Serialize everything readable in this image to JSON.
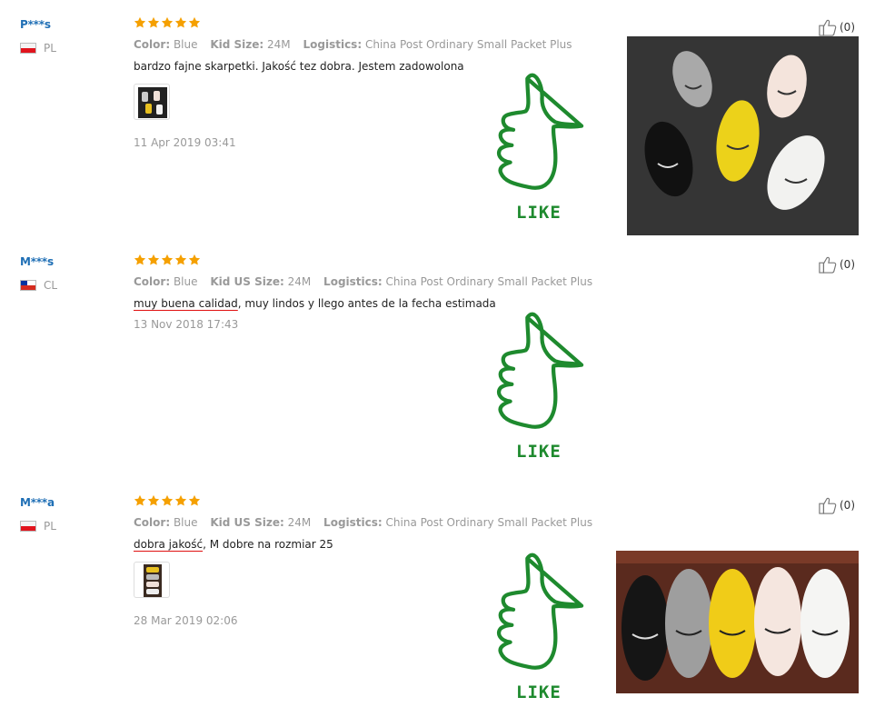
{
  "reviews": [
    {
      "user": "P***s",
      "country": "PL",
      "rating": 5,
      "meta": {
        "color_label": "Color:",
        "color_value": "Blue",
        "size_label": "Kid Size:",
        "size_value": "24M",
        "logistics_label": "Logistics:",
        "logistics_value": "China Post Ordinary Small Packet Plus"
      },
      "text_plain": "bardzo fajne skarpetki. Jakość tez dobra. Jestem zadowolona",
      "date": "11 Apr 2019 03:41",
      "helpful_count": "(0)",
      "like_label": "LIKE"
    },
    {
      "user": "M***s",
      "country": "CL",
      "rating": 5,
      "meta": {
        "color_label": "Color:",
        "color_value": "Blue",
        "size_label": "Kid US Size:",
        "size_value": "24M",
        "logistics_label": "Logistics:",
        "logistics_value": "China Post Ordinary Small Packet Plus"
      },
      "text_underlined": "muy buena calidad",
      "text_rest": ", muy lindos y llego antes de la fecha estimada",
      "date": "13 Nov 2018 17:43",
      "helpful_count": "(0)",
      "like_label": "LIKE"
    },
    {
      "user": "M***a",
      "country": "PL",
      "rating": 5,
      "meta": {
        "color_label": "Color:",
        "color_value": "Blue",
        "size_label": "Kid US Size:",
        "size_value": "24M",
        "logistics_label": "Logistics:",
        "logistics_value": "China Post Ordinary Small Packet Plus"
      },
      "text_underlined": "dobra jakość",
      "text_rest": ", M dobre na rozmiar 25",
      "date": "28 Mar 2019 02:06",
      "helpful_count": "(0)",
      "like_label": "LIKE"
    }
  ],
  "colors": {
    "username": "#1f6fb5",
    "star": "#f5a000",
    "like_green": "#1e8a2e",
    "underline_red": "#e01010",
    "meta_gray": "#999999"
  },
  "icons": [
    "thumbs-up-icon",
    "star-icon",
    "flag-icon"
  ]
}
